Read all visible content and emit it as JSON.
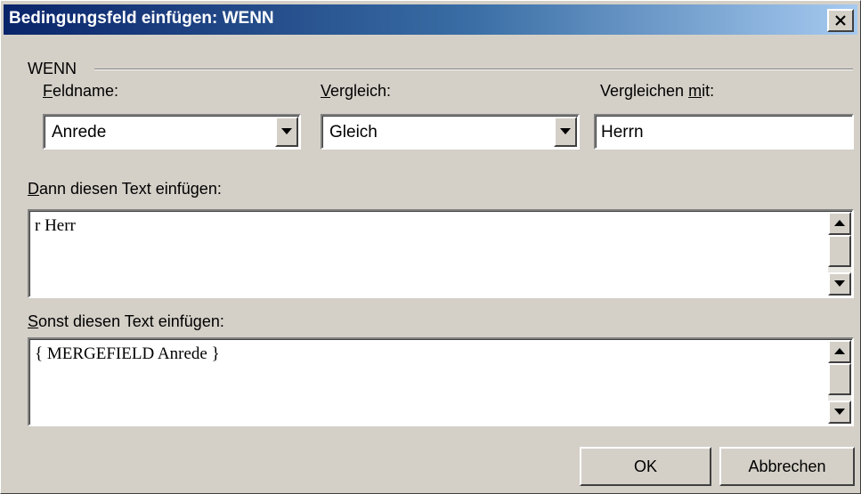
{
  "dialog": {
    "title": "Bedingungsfeld einfügen: WENN",
    "close_label": "×"
  },
  "group": {
    "label": "WENN"
  },
  "fieldname": {
    "label_accel": "F",
    "label_rest": "eldname:",
    "value": "Anrede"
  },
  "comparison": {
    "label_accel": "V",
    "label_rest": "ergleich:",
    "value": "Gleich"
  },
  "compare_with": {
    "label_pre": "Vergleichen ",
    "label_accel": "m",
    "label_rest": "it:",
    "value": "Herrn"
  },
  "then_text": {
    "label_accel": "D",
    "label_rest": "ann diesen Text einfügen:",
    "value": "r Herr"
  },
  "else_text": {
    "label_accel": "S",
    "label_rest": "onst diesen Text einfügen:",
    "value": "{ MERGEFIELD Anrede }"
  },
  "buttons": {
    "ok_label": "OK",
    "cancel_label": "Abbrechen"
  },
  "icons": [
    "close-icon",
    "chevron-down-icon",
    "scroll-up-arrow-icon",
    "scroll-down-arrow-icon"
  ],
  "colors": {
    "title_start": "#0a246a",
    "title_end": "#a6caf0",
    "face": "#d4d0c8"
  }
}
